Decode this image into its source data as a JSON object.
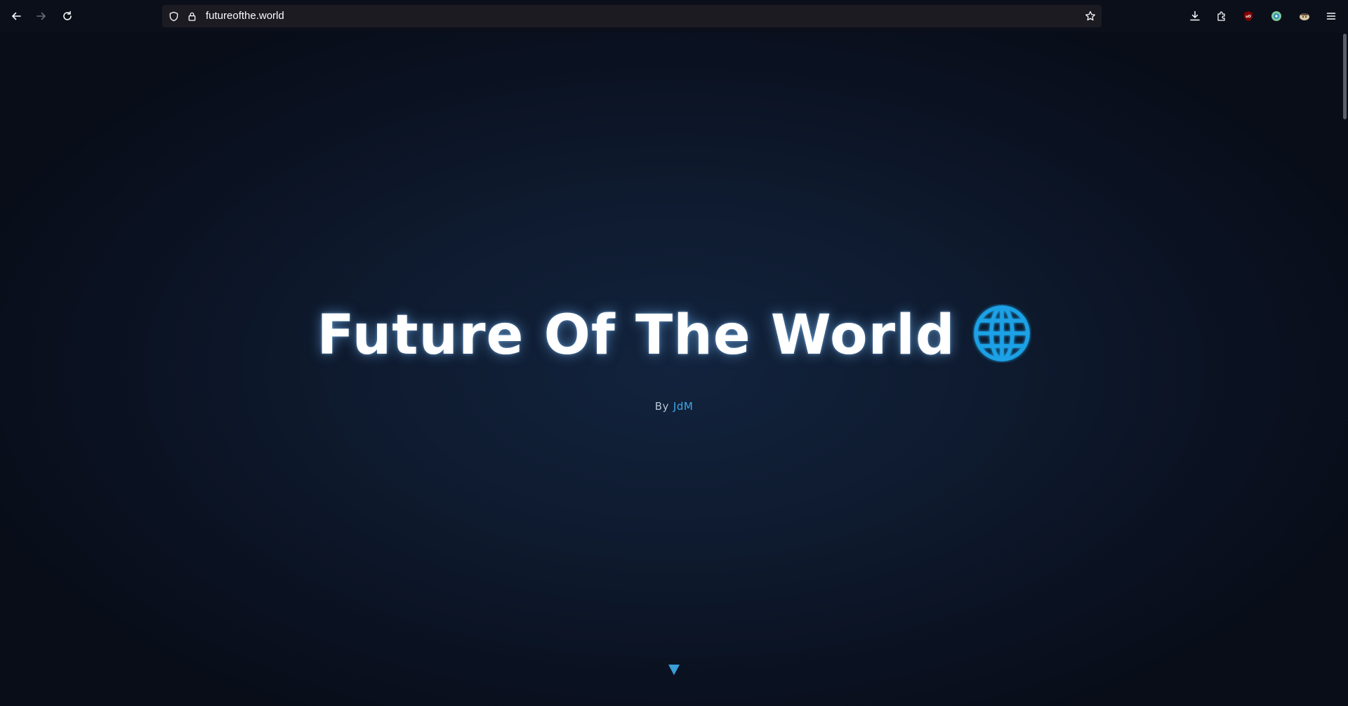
{
  "browser": {
    "url": "futureofthe.world"
  },
  "hero": {
    "title": "Future Of The World",
    "byline_prefix": "By",
    "author": "JdM"
  },
  "icons": {
    "back": "back-arrow-icon",
    "forward": "forward-arrow-icon",
    "reload": "reload-icon",
    "shield": "shield-icon",
    "lock": "lock-icon",
    "bookmark": "star-icon",
    "downloads": "download-icon",
    "extensions": "puzzle-icon",
    "ublock": "ublock-icon",
    "ext2": "extension-globe-icon",
    "ext3": "extension-avatar-icon",
    "menu": "hamburger-menu-icon",
    "globe": "globe-icon",
    "scroll": "down-triangle-icon"
  },
  "colors": {
    "accent": "#3fa6e8",
    "background": "#0b0f1a",
    "globe": "#1da1e6"
  }
}
